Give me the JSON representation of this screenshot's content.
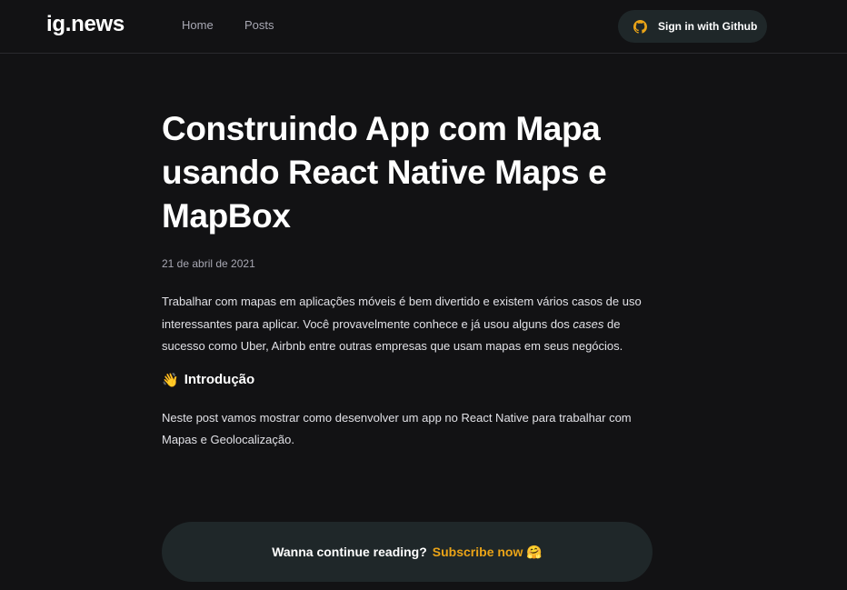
{
  "header": {
    "logo": "ig.news",
    "nav": {
      "home": "Home",
      "posts": "Posts"
    },
    "signin": {
      "label": "Sign in with Github",
      "icon": "github-icon",
      "icon_color": "#eba417"
    }
  },
  "post": {
    "title": "Construindo App com Mapa usando React Native Maps e MapBox",
    "date": "21 de abril de 2021",
    "paragraph1": {
      "before": "Trabalhar com mapas em aplicações móveis é bem divertido e existem vários casos de uso interessantes para aplicar. Você provavelmente conhece e já usou alguns dos ",
      "emphasis": "cases",
      "after": " de sucesso como Uber, Airbnb entre outras empresas que usam mapas em seus negócios."
    },
    "section": {
      "emoji": "👋",
      "heading": "Introdução"
    },
    "paragraph2": "Neste post vamos mostrar como desenvolver um app no React Native para trabalhar com Mapas e Geolocalização."
  },
  "cta": {
    "text": "Wanna continue reading?",
    "link": "Subscribe now",
    "emoji": "🤗",
    "accent": "#eba417"
  },
  "colors": {
    "background": "#121214",
    "surface": "#1f2729",
    "accent": "#eba417"
  }
}
